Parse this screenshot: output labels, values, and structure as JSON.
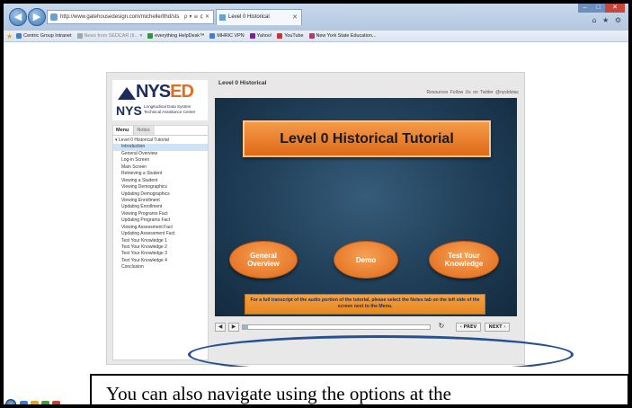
{
  "browser": {
    "url": "http://www.gatehousedesign.com/michelle/lthd/sts",
    "url_icons": "ρ ▾ ≡ ¢ ✕",
    "tab_title": "Level 0 Historical",
    "tab_close": "✕",
    "window_controls": [
      "–",
      "□",
      "✕"
    ],
    "right_icons": "⌂ ★ ⚙",
    "nav_back": "◀",
    "nav_forward": "▶",
    "favorites": [
      {
        "label": "Centric Group Intranet",
        "icon_color": "#3b7dd8"
      },
      {
        "label": "News from SEDCAR (It... ▾",
        "icon_color": "#9aa",
        "dim": true
      },
      {
        "label": "everything HelpDesk™",
        "icon_color": "#2a9a3a"
      },
      {
        "label": "MHRIC VPN",
        "icon_color": "#3b7dd8"
      },
      {
        "label": "Yahoo!",
        "icon_color": "#7b1fa2"
      },
      {
        "label": "YouTube",
        "icon_color": "#d32f2f"
      },
      {
        "label": "New York State Education...",
        "icon_color": "#b03a6a"
      }
    ]
  },
  "player": {
    "logo_top": "NYS",
    "logo_top_accent": "ED",
    "logo_bottom": "NYS",
    "logo_sub": "Longitudinal Data System Technical Assistance Center",
    "course_title": "Level 0 Historical",
    "top_links": "Resources   Follow Us on Twitter @nysldstac",
    "sidebar_tabs": {
      "menu": "Menu",
      "notes": "Notes"
    },
    "menu_items": [
      "▾ Level 0 Historical Tutorial",
      "Introduction",
      "General Overview",
      "Log-in Screen",
      "Main Screen",
      "Retrieving a Student",
      "Viewing a Student",
      "Viewing Demographics",
      "Updating Demographics",
      "Viewing Enrollment",
      "Updating Enrollment",
      "Viewing Programs Fact",
      "Updating Programs Fact",
      "Viewing Assessment Fact",
      "Updating Assessment Fact",
      "Test Your Knowledge 1",
      "Test Your Knowledge 2",
      "Test Your Knowledge 3",
      "Test Your Knowledge 4",
      "Conclusion"
    ],
    "selected_menu_index": 1,
    "slide_title": "Level 0 Historical Tutorial",
    "buttons": {
      "general_overview": "General Overview",
      "demo": "Demo",
      "test_knowledge": "Test Your Knowledge"
    },
    "transcript_note": "For a full transcript of the audio portion of the tutorial, please select the Notes tab on the left side of the screen next to the Menu.",
    "controls": {
      "volume": "◀",
      "play": "▶",
      "replay": "↻",
      "prev": "‹ PREV",
      "next": "NEXT ›",
      "progress": 0.03
    }
  },
  "caption": "You can also navigate using the options at the"
}
